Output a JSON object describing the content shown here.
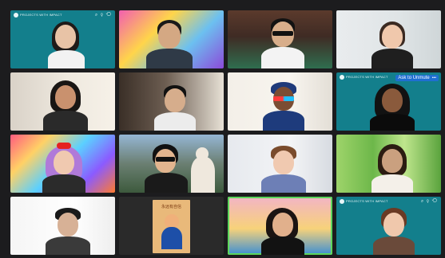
{
  "meeting": {
    "tiles": [
      {
        "id": "t1",
        "has_logo": true,
        "logo_text": "PROJECTS WITH IMPACT"
      },
      {
        "id": "t2"
      },
      {
        "id": "t3"
      },
      {
        "id": "t4"
      },
      {
        "id": "t5"
      },
      {
        "id": "t6"
      },
      {
        "id": "t7"
      },
      {
        "id": "t8",
        "has_logo": true,
        "logo_text": "PROJECTS WITH IMPACT",
        "unmute_label": "Ask to Unmute",
        "more_label": "•••"
      },
      {
        "id": "t9"
      },
      {
        "id": "t10"
      },
      {
        "id": "t11"
      },
      {
        "id": "t12"
      },
      {
        "id": "t13"
      },
      {
        "id": "t14",
        "poster_text": "永远有自信"
      },
      {
        "id": "t15",
        "active_speaker": true
      },
      {
        "id": "t16",
        "has_logo": true,
        "logo_text": "PROJECTS WITH IMPACT"
      }
    ]
  },
  "colors": {
    "window_bg": "#1c1c1e",
    "brand_teal": "#137f8c",
    "active_speaker_outline": "#5cd65c",
    "unmute_button": "#1f6fd1"
  },
  "icons": {
    "tile1_top_right": "⌕ ⚲ ⟲",
    "tile16_top_right": "⌕ ⚲ ⟲"
  }
}
